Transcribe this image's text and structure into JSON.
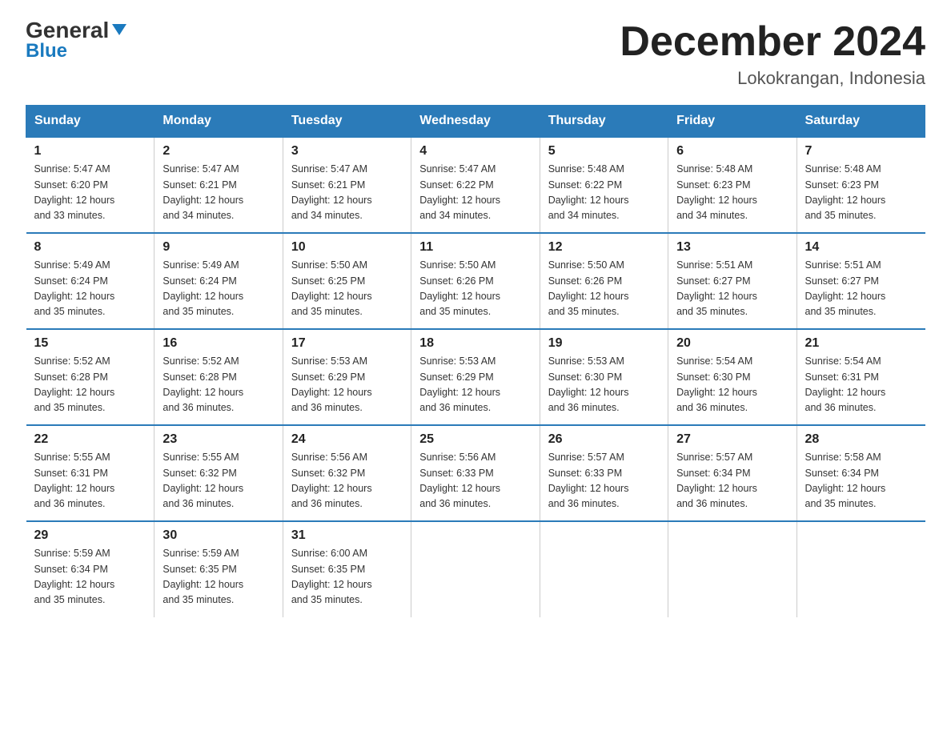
{
  "logo": {
    "general": "General",
    "blue": "Blue"
  },
  "header": {
    "month_year": "December 2024",
    "location": "Lokokrangan, Indonesia"
  },
  "columns": [
    "Sunday",
    "Monday",
    "Tuesday",
    "Wednesday",
    "Thursday",
    "Friday",
    "Saturday"
  ],
  "weeks": [
    [
      {
        "day": "1",
        "sunrise": "5:47 AM",
        "sunset": "6:20 PM",
        "daylight": "12 hours and 33 minutes."
      },
      {
        "day": "2",
        "sunrise": "5:47 AM",
        "sunset": "6:21 PM",
        "daylight": "12 hours and 34 minutes."
      },
      {
        "day": "3",
        "sunrise": "5:47 AM",
        "sunset": "6:21 PM",
        "daylight": "12 hours and 34 minutes."
      },
      {
        "day": "4",
        "sunrise": "5:47 AM",
        "sunset": "6:22 PM",
        "daylight": "12 hours and 34 minutes."
      },
      {
        "day": "5",
        "sunrise": "5:48 AM",
        "sunset": "6:22 PM",
        "daylight": "12 hours and 34 minutes."
      },
      {
        "day": "6",
        "sunrise": "5:48 AM",
        "sunset": "6:23 PM",
        "daylight": "12 hours and 34 minutes."
      },
      {
        "day": "7",
        "sunrise": "5:48 AM",
        "sunset": "6:23 PM",
        "daylight": "12 hours and 35 minutes."
      }
    ],
    [
      {
        "day": "8",
        "sunrise": "5:49 AM",
        "sunset": "6:24 PM",
        "daylight": "12 hours and 35 minutes."
      },
      {
        "day": "9",
        "sunrise": "5:49 AM",
        "sunset": "6:24 PM",
        "daylight": "12 hours and 35 minutes."
      },
      {
        "day": "10",
        "sunrise": "5:50 AM",
        "sunset": "6:25 PM",
        "daylight": "12 hours and 35 minutes."
      },
      {
        "day": "11",
        "sunrise": "5:50 AM",
        "sunset": "6:26 PM",
        "daylight": "12 hours and 35 minutes."
      },
      {
        "day": "12",
        "sunrise": "5:50 AM",
        "sunset": "6:26 PM",
        "daylight": "12 hours and 35 minutes."
      },
      {
        "day": "13",
        "sunrise": "5:51 AM",
        "sunset": "6:27 PM",
        "daylight": "12 hours and 35 minutes."
      },
      {
        "day": "14",
        "sunrise": "5:51 AM",
        "sunset": "6:27 PM",
        "daylight": "12 hours and 35 minutes."
      }
    ],
    [
      {
        "day": "15",
        "sunrise": "5:52 AM",
        "sunset": "6:28 PM",
        "daylight": "12 hours and 35 minutes."
      },
      {
        "day": "16",
        "sunrise": "5:52 AM",
        "sunset": "6:28 PM",
        "daylight": "12 hours and 36 minutes."
      },
      {
        "day": "17",
        "sunrise": "5:53 AM",
        "sunset": "6:29 PM",
        "daylight": "12 hours and 36 minutes."
      },
      {
        "day": "18",
        "sunrise": "5:53 AM",
        "sunset": "6:29 PM",
        "daylight": "12 hours and 36 minutes."
      },
      {
        "day": "19",
        "sunrise": "5:53 AM",
        "sunset": "6:30 PM",
        "daylight": "12 hours and 36 minutes."
      },
      {
        "day": "20",
        "sunrise": "5:54 AM",
        "sunset": "6:30 PM",
        "daylight": "12 hours and 36 minutes."
      },
      {
        "day": "21",
        "sunrise": "5:54 AM",
        "sunset": "6:31 PM",
        "daylight": "12 hours and 36 minutes."
      }
    ],
    [
      {
        "day": "22",
        "sunrise": "5:55 AM",
        "sunset": "6:31 PM",
        "daylight": "12 hours and 36 minutes."
      },
      {
        "day": "23",
        "sunrise": "5:55 AM",
        "sunset": "6:32 PM",
        "daylight": "12 hours and 36 minutes."
      },
      {
        "day": "24",
        "sunrise": "5:56 AM",
        "sunset": "6:32 PM",
        "daylight": "12 hours and 36 minutes."
      },
      {
        "day": "25",
        "sunrise": "5:56 AM",
        "sunset": "6:33 PM",
        "daylight": "12 hours and 36 minutes."
      },
      {
        "day": "26",
        "sunrise": "5:57 AM",
        "sunset": "6:33 PM",
        "daylight": "12 hours and 36 minutes."
      },
      {
        "day": "27",
        "sunrise": "5:57 AM",
        "sunset": "6:34 PM",
        "daylight": "12 hours and 36 minutes."
      },
      {
        "day": "28",
        "sunrise": "5:58 AM",
        "sunset": "6:34 PM",
        "daylight": "12 hours and 35 minutes."
      }
    ],
    [
      {
        "day": "29",
        "sunrise": "5:59 AM",
        "sunset": "6:34 PM",
        "daylight": "12 hours and 35 minutes."
      },
      {
        "day": "30",
        "sunrise": "5:59 AM",
        "sunset": "6:35 PM",
        "daylight": "12 hours and 35 minutes."
      },
      {
        "day": "31",
        "sunrise": "6:00 AM",
        "sunset": "6:35 PM",
        "daylight": "12 hours and 35 minutes."
      },
      null,
      null,
      null,
      null
    ]
  ],
  "labels": {
    "sunrise": "Sunrise:",
    "sunset": "Sunset:",
    "daylight": "Daylight:"
  }
}
